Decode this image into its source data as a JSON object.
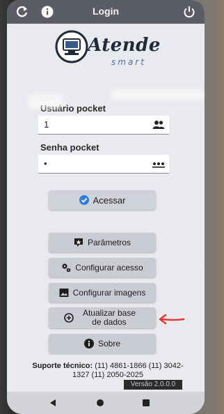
{
  "header": {
    "title": "Login",
    "refresh_icon": "refresh-icon",
    "info_icon": "info-icon",
    "power_icon": "power-icon"
  },
  "logo": {
    "brand": "Atende",
    "tagline": "smart"
  },
  "form": {
    "user_label": "Usuário pocket",
    "user_value": "1",
    "user_icon": "users-icon",
    "password_label": "Senha pocket",
    "password_value": "•",
    "password_icon": "password-dots-icon"
  },
  "buttons": {
    "login": "Acessar",
    "parameters": "Parâmetros",
    "configure_access": "Configurar acesso",
    "configure_images": "Configurar imagens",
    "update_database": "Atualizar base de dados",
    "about": "Sobre"
  },
  "footer": {
    "support_label": "Suporte técnico:",
    "support_phones": "(11) 4861-1866 (11) 3042-1327 (11) 2050-2025",
    "version": "Versão 2.0.0.0"
  },
  "colors": {
    "accent": "#2f7fd9",
    "annotation": "#e53935"
  }
}
